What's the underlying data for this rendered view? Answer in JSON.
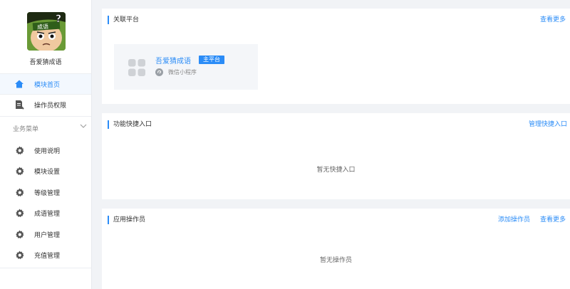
{
  "sidebar": {
    "app_name": "吾爱猜成语",
    "avatar_text": "成语",
    "items": [
      {
        "label": "模块首页",
        "icon": "home-icon",
        "active": true
      },
      {
        "label": "操作员权限",
        "icon": "permission-doc-icon"
      }
    ],
    "group_title": "业务菜单",
    "group_items": [
      {
        "label": "使用说明",
        "icon": "gear-icon"
      },
      {
        "label": "模块设置",
        "icon": "gear-icon"
      },
      {
        "label": "等级管理",
        "icon": "gear-icon"
      },
      {
        "label": "成语管理",
        "icon": "gear-icon"
      },
      {
        "label": "用户管理",
        "icon": "gear-icon"
      },
      {
        "label": "充值管理",
        "icon": "gear-icon"
      }
    ]
  },
  "linked_platforms": {
    "title": "关联平台",
    "more_link": "查看更多",
    "platform": {
      "name": "吾爱猜成语",
      "badge": "主平台",
      "type": "微信小程序"
    }
  },
  "shortcuts": {
    "title": "功能快捷入口",
    "manage_link": "管理快捷入口",
    "empty_text": "暂无快捷入口"
  },
  "operators": {
    "title": "应用操作员",
    "add_link": "添加操作员",
    "more_link": "查看更多",
    "empty_text": "暂无操作员"
  },
  "colors": {
    "accent": "#2b8cf7",
    "background": "#f1f3f6"
  }
}
